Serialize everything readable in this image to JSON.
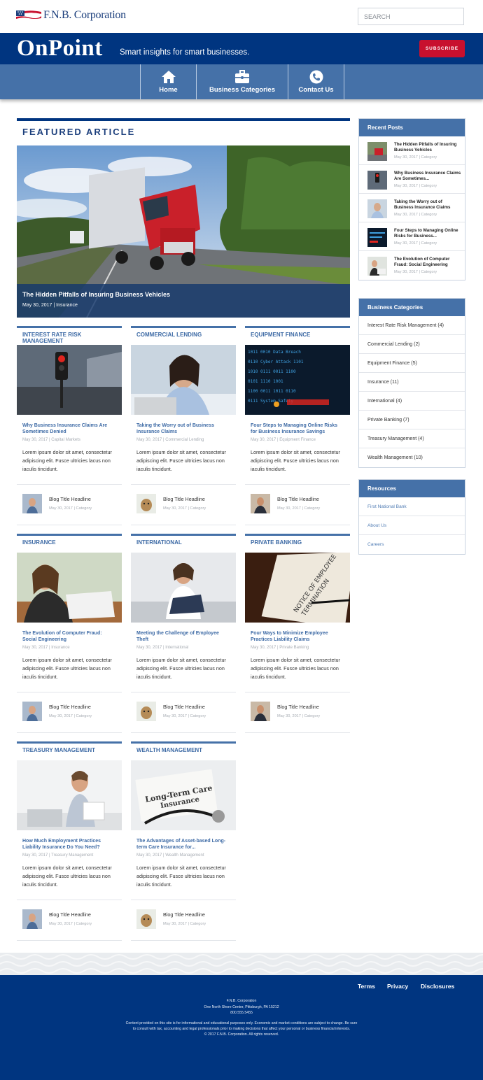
{
  "header": {
    "logo_text": "F.N.B. Corporation",
    "search_placeholder": "SEARCH"
  },
  "brand": {
    "title": "OnPoint",
    "tagline": "Smart insights for smart businesses.",
    "subscribe_label": "SUBSCRIBE"
  },
  "nav": {
    "items": [
      {
        "label": "Home",
        "icon": "home-icon"
      },
      {
        "label": "Business Categories",
        "icon": "briefcase-icon"
      },
      {
        "label": "Contact Us",
        "icon": "phone-icon"
      }
    ]
  },
  "featured": {
    "heading": "FEATURED ARTICLE",
    "title": "The Hidden Pitfalls of Insuring Business Vehicles",
    "meta": "May 30, 2017  |  Insurance"
  },
  "cards": [
    {
      "category": "INTEREST RATE RISK MANAGEMENT",
      "title": "Why Business Insurance Claims Are Sometimes Denied",
      "meta": "May 30, 2017  |  Capital Markets",
      "body": "Lorem ipsum dolor sit amet, consectetur adipiscing elit. Fusce ultricies lacus non iaculis tincidunt.",
      "mini_title": "Blog Title Headline",
      "mini_meta": "May 30, 2017 | Category"
    },
    {
      "category": "COMMERCIAL LENDING",
      "title": "Taking the Worry out of Business Insurance Claims",
      "meta": "May 30, 2017  |  Commercial Lending",
      "body": "Lorem ipsum dolor sit amet, consectetur adipiscing elit. Fusce ultricies lacus non iaculis tincidunt.",
      "mini_title": "Blog Title Headline",
      "mini_meta": "May 30, 2017 | Category"
    },
    {
      "category": "EQUIPMENT FINANCE",
      "title": "Four Steps to Managing Online Risks for Business Insurance Savings",
      "meta": "May 30, 2017  |  Equipment Finance",
      "body": "Lorem ipsum dolor sit amet, consectetur adipiscing elit. Fusce ultricies lacus non iaculis tincidunt.",
      "mini_title": "Blog Title Headline",
      "mini_meta": "May 30, 2017 | Category"
    },
    {
      "category": "INSURANCE",
      "title": "The Evolution of Computer Fraud: Social Engineering",
      "meta": "May 30, 2017  |  Insurance",
      "body": "Lorem ipsum dolor sit amet, consectetur adipiscing elit. Fusce ultricies lacus non iaculis tincidunt.",
      "mini_title": "Blog Title Headline",
      "mini_meta": "May 30, 2017 | Category"
    },
    {
      "category": "INTERNATIONAL",
      "title": "Meeting the Challenge of Employee Theft",
      "meta": "May 30, 2017  |  International",
      "body": "Lorem ipsum dolor sit amet, consectetur adipiscing elit. Fusce ultricies lacus non iaculis tincidunt.",
      "mini_title": "Blog Title Headline",
      "mini_meta": "May 30, 2017 | Category"
    },
    {
      "category": "PRIVATE BANKING",
      "title": "Four Ways to Minimize Employee Practices Liability Claims",
      "meta": "May 30, 2017  |  Private Banking",
      "body": "Lorem ipsum dolor sit amet, consectetur adipiscing elit. Fusce ultricies lacus non iaculis tincidunt.",
      "mini_title": "Blog Title Headline",
      "mini_meta": "May 30, 2017 | Category"
    },
    {
      "category": "TREASURY MANAGEMENT",
      "title": "How Much Employment Practices Liability Insurance Do You Need?",
      "meta": "May 30, 2017  |  Treasury Management",
      "body": "Lorem ipsum dolor sit amet, consectetur adipiscing elit. Fusce ultricies lacus non iaculis tincidunt.",
      "mini_title": "Blog Title Headline",
      "mini_meta": "May 30, 2017 | Category"
    },
    {
      "category": "WEALTH MANAGEMENT",
      "title": "The Advantages of Asset-based Long-term Care Insurance for...",
      "meta": "May 30, 2017  |  Wealth Management",
      "body": "Lorem ipsum dolor sit amet, consectetur adipiscing elit. Fusce ultricies lacus non iaculis tincidunt.",
      "mini_title": "Blog Title Headline",
      "mini_meta": "May 30, 2017 | Category"
    }
  ],
  "sidebar": {
    "recent_heading": "Recent Posts",
    "recent": [
      {
        "title": "The Hidden Pitfalls of Insuring Business Vehicles",
        "meta": "May 30, 2017 | Category"
      },
      {
        "title": "Why Business Insurance Claims Are Sometimes...",
        "meta": "May 30, 2017 | Category"
      },
      {
        "title": "Taking the Worry out of Business Insurance Claims",
        "meta": "May 30, 2017 | Category"
      },
      {
        "title": "Four Steps to Managing Online Risks for Business...",
        "meta": "May 30, 2017 | Category"
      },
      {
        "title": "The Evolution of Computer Fraud: Social Engineering",
        "meta": "May 30, 2017 | Category"
      }
    ],
    "categories_heading": "Business Categories",
    "categories": [
      "Interest Rate Risk Management (4)",
      "Commercial Lending (2)",
      "Equipment Finance (5)",
      "Insurance (11)",
      "International (4)",
      "Private Banking (7)",
      "Treasury Management (4)",
      "Wealth Management (10)"
    ],
    "resources_heading": "Resources",
    "resources": [
      "First National Bank",
      "About Us",
      "Careers"
    ]
  },
  "footer": {
    "links": [
      "Terms",
      "Privacy",
      "Disclosures"
    ],
    "company": "F.N.B. Corporation",
    "address": "One North Shore Center, Pittsburgh, PA 15212",
    "phone": "800.555.5455",
    "disclaimer_1": "Content provided on this site is for informational and educational purposes only. Economic and market conditions are subject to change. Be sure",
    "disclaimer_2": "to consult with tax, accounting and legal professionals prior to making decisions that affect your personal or business financial interests.",
    "copyright": "© 2017 F.N.B. Corporation. All rights reserved."
  },
  "colors": {
    "navy": "#003580",
    "nav_blue": "#4571a8",
    "subscribe_red": "#c8102e",
    "link_blue": "#3d6aa5"
  }
}
